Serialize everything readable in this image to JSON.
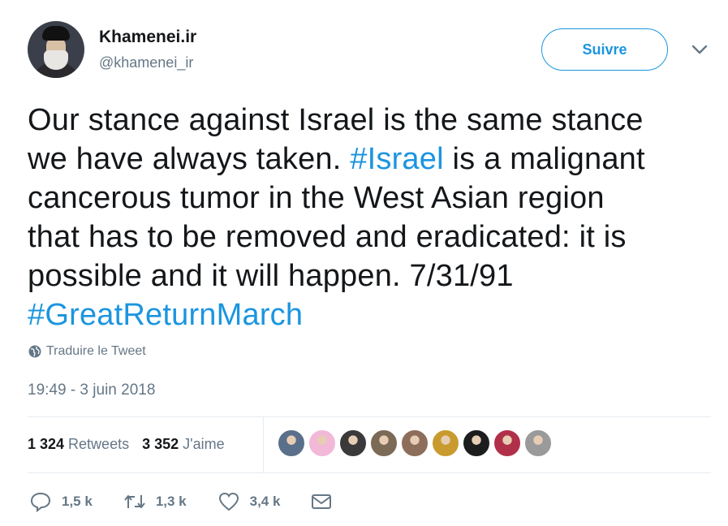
{
  "user": {
    "name": "Khamenei.ir",
    "handle": "@khamenei_ir",
    "follow_label": "Suivre"
  },
  "tweet": {
    "line1": "Our stance against Israel is the same stance",
    "line2a": "we have always taken. ",
    "hashtag1": "#Israel",
    "line2b": " is a malignant",
    "line3": "cancerous tumor in the West Asian region",
    "line4": "that has to be removed and eradicated: it is",
    "line5": "possible and it will happen. 7/31/91",
    "hashtag2": "#GreatReturnMarch"
  },
  "translate_label": "Traduire le Tweet",
  "timestamp": "19:49 - 3 juin 2018",
  "stats": {
    "retweets_count": "1 324",
    "retweets_label": "Retweets",
    "likes_count": "3 352",
    "likes_label": "J'aime"
  },
  "liker_colors": [
    "#5a6f8a",
    "#f2b8d8",
    "#3a3a3a",
    "#7b6a55",
    "#8d6e5a",
    "#c99a2e",
    "#1d1d1d",
    "#b0304a",
    "#9a9a9a"
  ],
  "actions": {
    "replies": "1,5 k",
    "retweets": "1,3 k",
    "likes": "3,4 k"
  },
  "colors": {
    "link": "#1b95e0",
    "muted": "#657786",
    "text": "#14171a"
  }
}
